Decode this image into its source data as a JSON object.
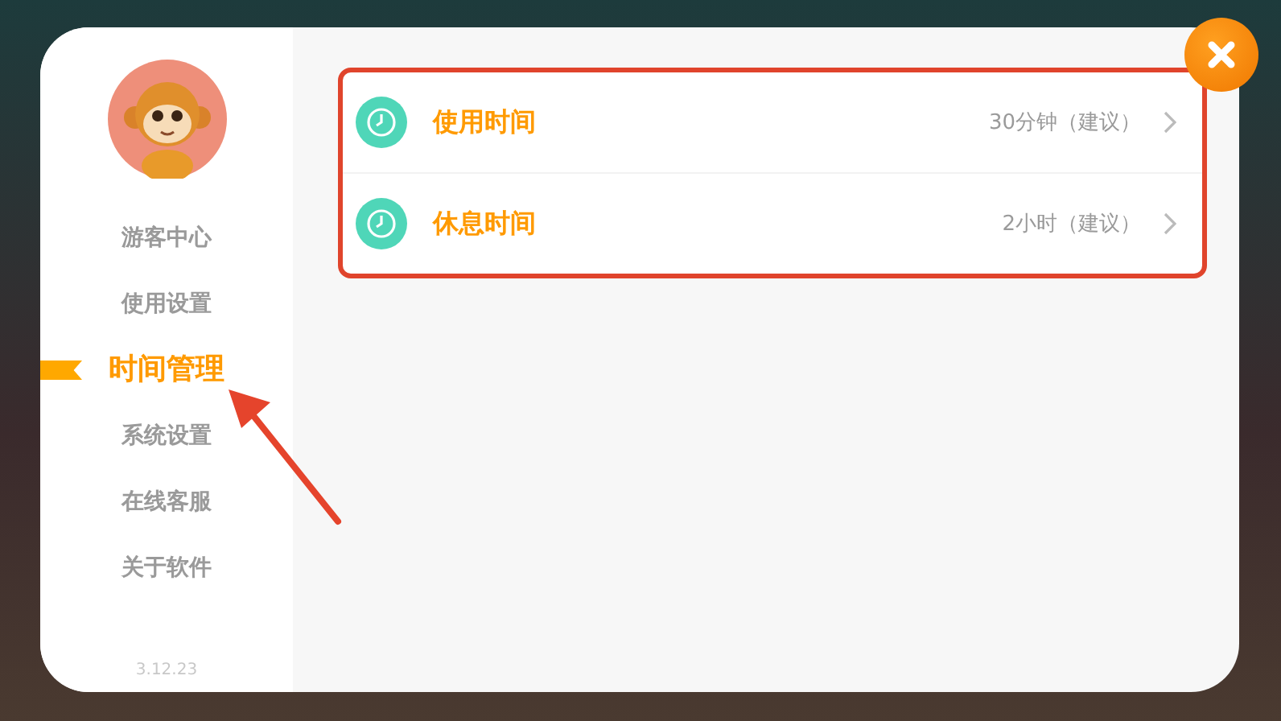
{
  "sidebar": {
    "items": [
      {
        "label": "游客中心",
        "selected": false
      },
      {
        "label": "使用设置",
        "selected": false
      },
      {
        "label": "时间管理",
        "selected": true
      },
      {
        "label": "系统设置",
        "selected": false
      },
      {
        "label": "在线客服",
        "selected": false
      },
      {
        "label": "关于软件",
        "selected": false
      }
    ],
    "version": "3.12.23"
  },
  "settings": [
    {
      "label": "使用时间",
      "value": "30分钟（建议）"
    },
    {
      "label": "休息时间",
      "value": "2小时（建议）"
    }
  ]
}
